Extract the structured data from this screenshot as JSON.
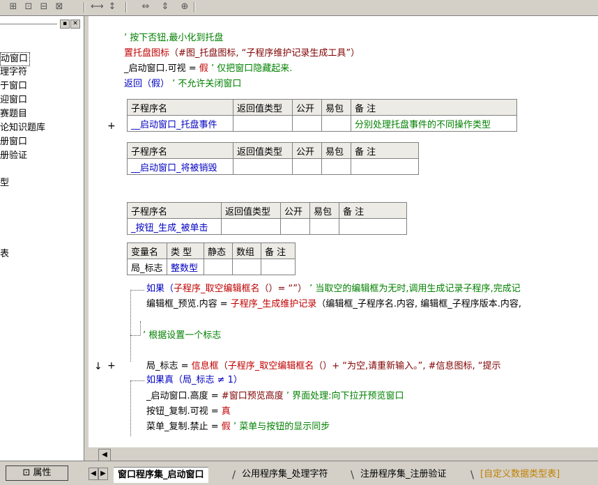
{
  "toolbar": {
    "icons": [
      "grid-icon",
      "align-top-icon",
      "align-middle-icon",
      "align-bottom-icon",
      "distribute-h-icon",
      "distribute-v-icon",
      "width-icon",
      "height-icon",
      "size-icon"
    ]
  },
  "left_panel": {
    "items": [
      "动窗口",
      "理字符",
      "于窗口",
      "迎窗口",
      "赛题目",
      "论知识题库",
      "册窗口",
      "册验证",
      "型",
      "表"
    ]
  },
  "code": {
    "comment1": "’ 按下否钮,最小化到托盘",
    "line2_fn": "置托盘图标",
    "line2_args": "（#图_托盘图标, “子程序维护记录生成工具”）",
    "line3_a": "_启动窗口.可视 = ",
    "line3_b": "假",
    "line3_c": " ’ 仅把窗口隐藏起来.",
    "line4_a": "返回（假）",
    "line4_b": " ’ 不允许关闭窗口",
    "t1_headers": [
      "子程序名",
      "返回值类型",
      "公开",
      "易包",
      "备 注"
    ],
    "t1_row": [
      "__启动窗口_托盘事件",
      "",
      "",
      "",
      "分别处理托盘事件的不同操作类型"
    ],
    "t2_headers": [
      "子程序名",
      "返回值类型",
      "公开",
      "易包",
      "备 注"
    ],
    "t2_row": [
      "__启动窗口_将被销毁",
      "",
      "",
      "",
      ""
    ],
    "t3_headers": [
      "子程序名",
      "返回值类型",
      "公开",
      "易包",
      "备 注"
    ],
    "t3_row": [
      "_按钮_生成_被单击",
      "",
      "",
      "",
      ""
    ],
    "t4_headers": [
      "变量名",
      "类 型",
      "静态",
      "数组",
      "备 注"
    ],
    "t4_row": [
      "局_标志",
      "整数型",
      "",
      "",
      ""
    ],
    "if1_a": "如果（",
    "if1_b": "子程序_取空编辑框名",
    "if1_c": "（）= “”）",
    "if1_d": " ’ 当取空的编辑框为无时,调用生成记录子程序,完成记",
    "l_edit_a": "编辑框_预览.内容 = ",
    "l_edit_b": "子程序_生成维护记录",
    "l_edit_c": "（编辑框_子程序名.内容, 编辑框_子程序版本.内容,",
    "comment_flag": "’ 根据设置一个标志",
    "flag_a": "局_标志 = ",
    "flag_b": "信息框",
    "flag_c": "（",
    "flag_d": "子程序_取空编辑框名",
    "flag_e": "（）+ “为空,请重新输入。”, #信息图标, “提示",
    "if2": "如果真（局_标志 ≠ 1）",
    "h_a": "_启动窗口.高度 = ",
    "h_b": "#窗口预览高度",
    "h_c": " ’ 界面处理:向下拉开预览窗口",
    "copy_vis_a": "按钮_复制.可视 = ",
    "copy_vis_b": "真",
    "menu_a": "菜单_复制.禁止 = ",
    "menu_b": "假",
    "menu_c": " ’ 菜单与按钮的显示同步",
    "plus": "+",
    "arrow": "↓",
    "plus2": "+"
  },
  "status": {
    "property_btn": "属性",
    "tabs": [
      "窗口程序集_启动窗口",
      "公用程序集_处理字符",
      "注册程序集_注册验证",
      "[自定义数据类型表]"
    ]
  }
}
